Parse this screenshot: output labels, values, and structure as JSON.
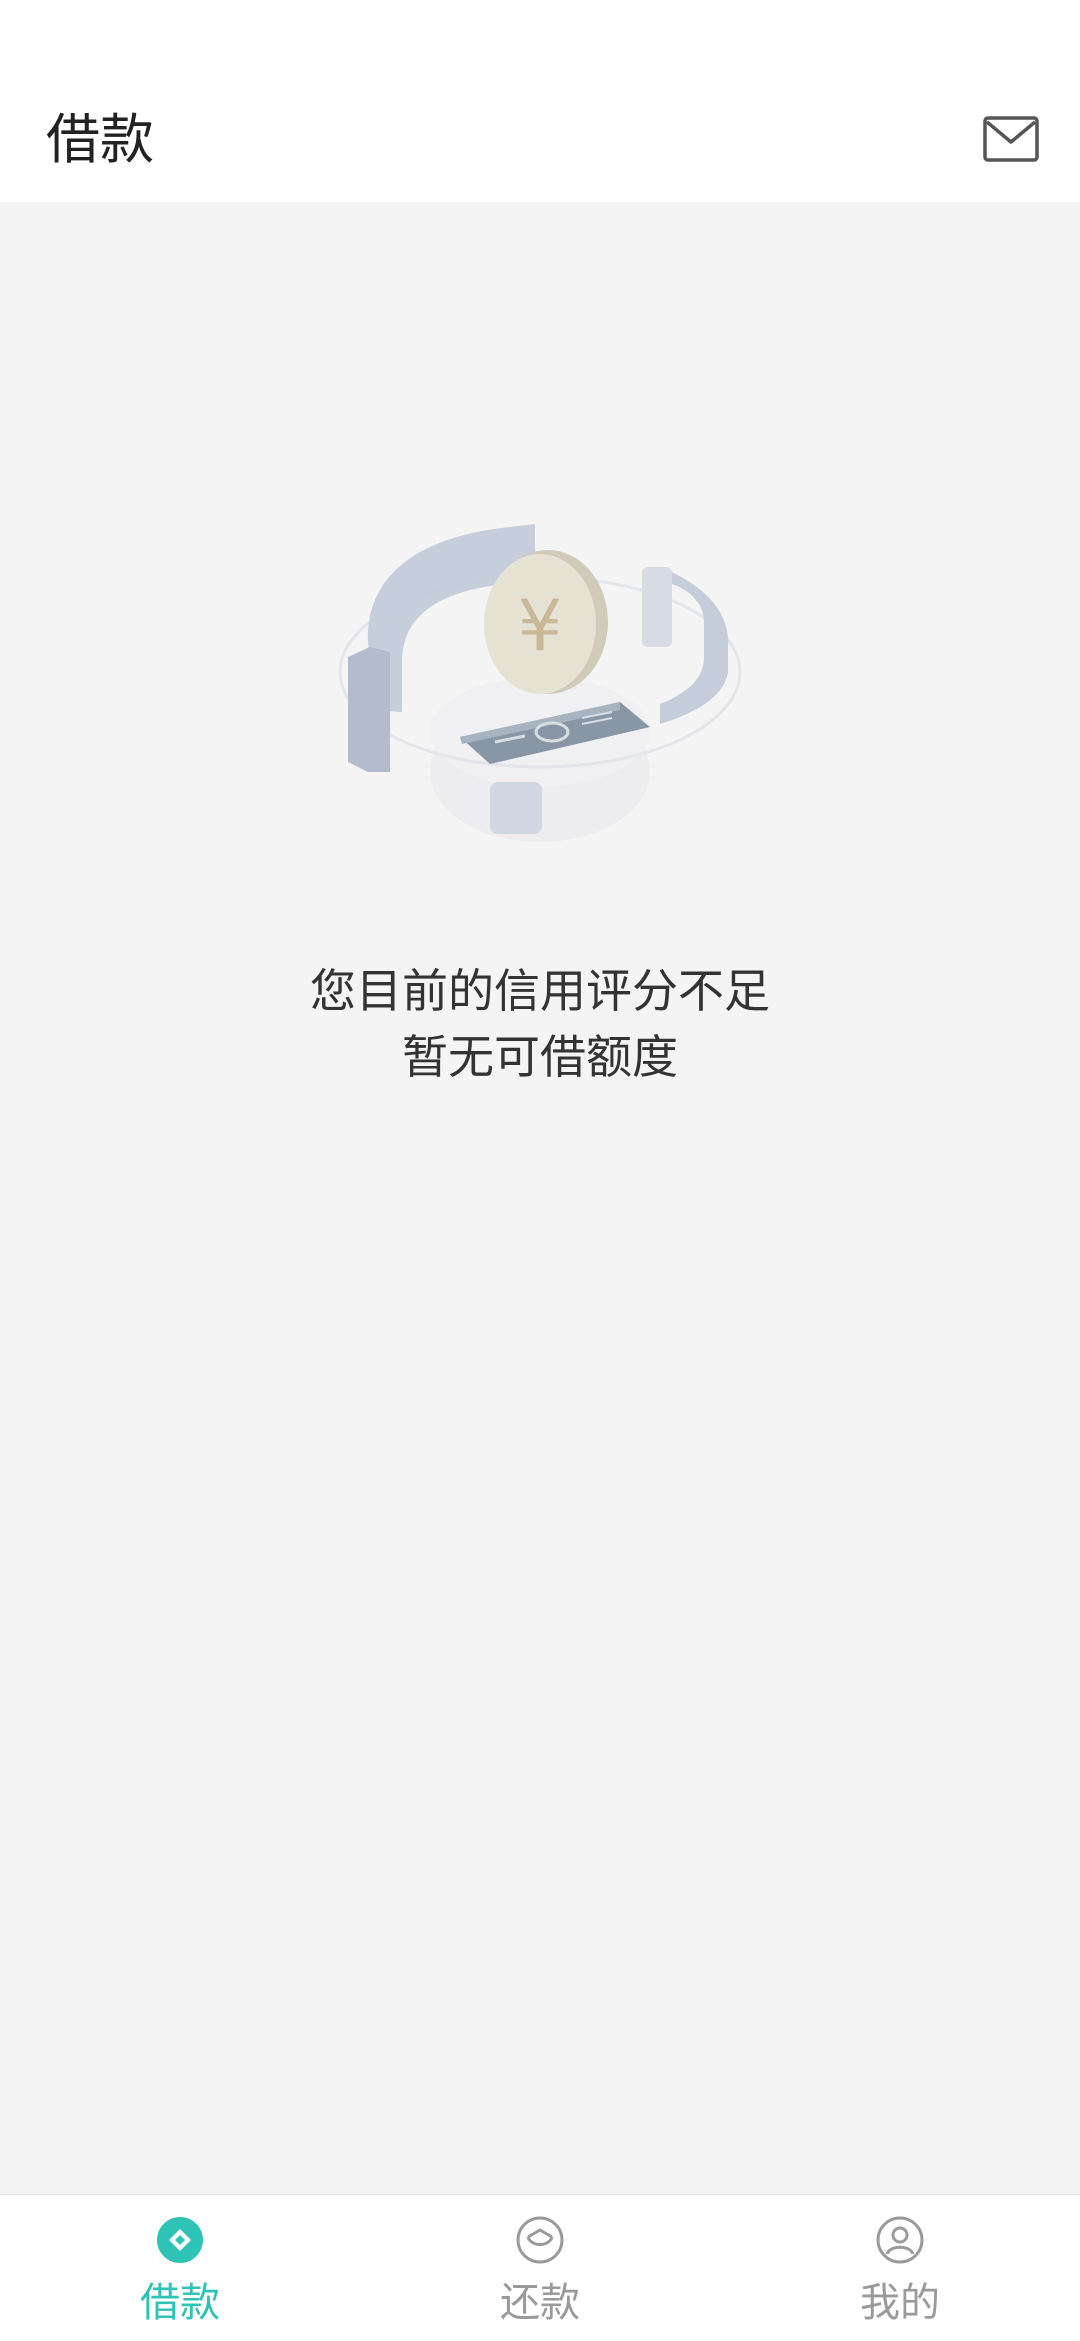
{
  "header": {
    "title": "借款",
    "mail_icon": "envelope-icon"
  },
  "empty_state": {
    "illustration_icon": "coin-phone-illustration",
    "line1": "您目前的信用评分不足",
    "line2": "暂无可借额度"
  },
  "tabs": [
    {
      "label": "借款",
      "icon": "loan-icon",
      "active": true
    },
    {
      "label": "还款",
      "icon": "repay-icon",
      "active": false
    },
    {
      "label": "我的",
      "icon": "profile-icon",
      "active": false
    }
  ],
  "colors": {
    "accent": "#2fc3b5",
    "inactive": "#9a9a9a",
    "background": "#f4f4f4"
  }
}
